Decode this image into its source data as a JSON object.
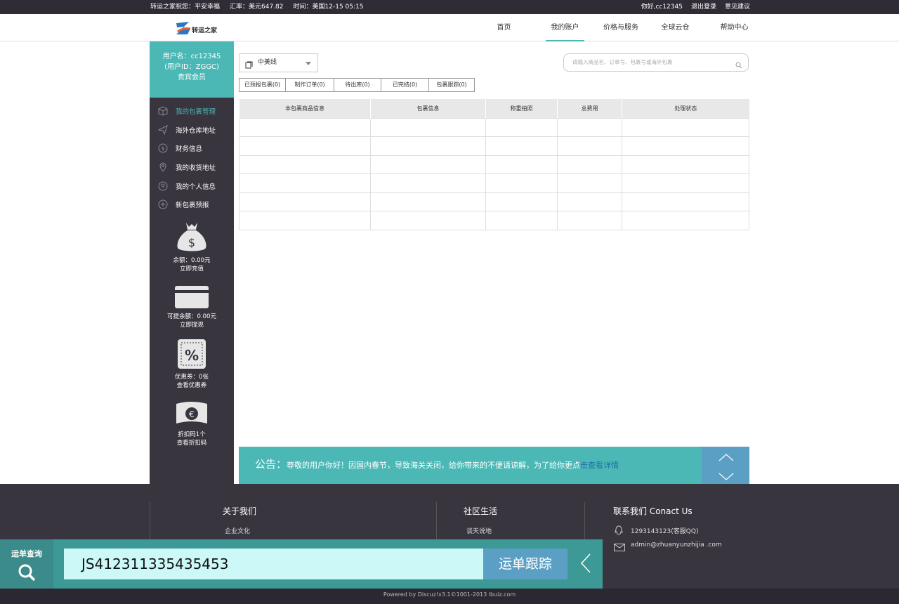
{
  "topbar": {
    "greeting": "转运之家祝您：平安幸福",
    "rate": "汇率：美元647.82",
    "time": "时间：美国12-15 05:15",
    "hello": "你好,cc12345",
    "logout": "退出登录",
    "feedback": "意见建议"
  },
  "logo": {
    "text": "转运之家"
  },
  "nav": [
    "首页",
    "我的账户",
    "价格与服务",
    "全球云仓",
    "帮助中心"
  ],
  "user": {
    "name": "用户名：cc12345",
    "id": "(用户ID：ZGGC)",
    "level": "贵宾会员"
  },
  "menu": [
    "我的包裹管理",
    "海外仓库地址",
    "财务信息",
    "我的收货地址",
    "我的个人信息",
    "新包裹预报"
  ],
  "widgets": {
    "balance": "余额：0.00元",
    "recharge": "立即充值",
    "withdrawable": "可提余额：0.00元",
    "withdraw": "立即提现",
    "coupon": "优惠券：0张",
    "coupon_link": "查看优惠券",
    "discount": "折扣码1个",
    "discount_link": "查看折扣码"
  },
  "line_select": "中美线",
  "search_placeholder": "请输入商品名、订单号、包裹号或海外包裹",
  "tabs": [
    "已预报包裹(0)",
    "制作订单(0)",
    "待出库(0)",
    "已完结(0)",
    "包裹跟踪(0)"
  ],
  "table_headers": [
    "本包裹商品信息",
    "包裹信息",
    "称重拍照",
    "总费用",
    "处理状态"
  ],
  "notice": {
    "label": "公告：",
    "text": "尊敬的用户你好！因国内春节，导致海关关闭，给你带来的不便请谅解，为了给你更点",
    "link": "击查看详情"
  },
  "footer": {
    "about_title": "关于我们",
    "about_item": "企业文化",
    "community_title": "社区生活",
    "community_item": "谈天说地",
    "contact_title": "联系我们 Conact Us",
    "qq": "1293143123(客服QQ)",
    "email": "admin@zhuanyunzhijia .com"
  },
  "tracking": {
    "label": "运单查询",
    "value": "JS412311335435453",
    "button": "运单跟踪"
  },
  "copyright": "Powered by Discuz!x3.1©1001-2013  ibuiz.com",
  "colors": {
    "accent": "#4bb8b6",
    "dark": "#38353f",
    "blue": "#5b9fc4"
  }
}
